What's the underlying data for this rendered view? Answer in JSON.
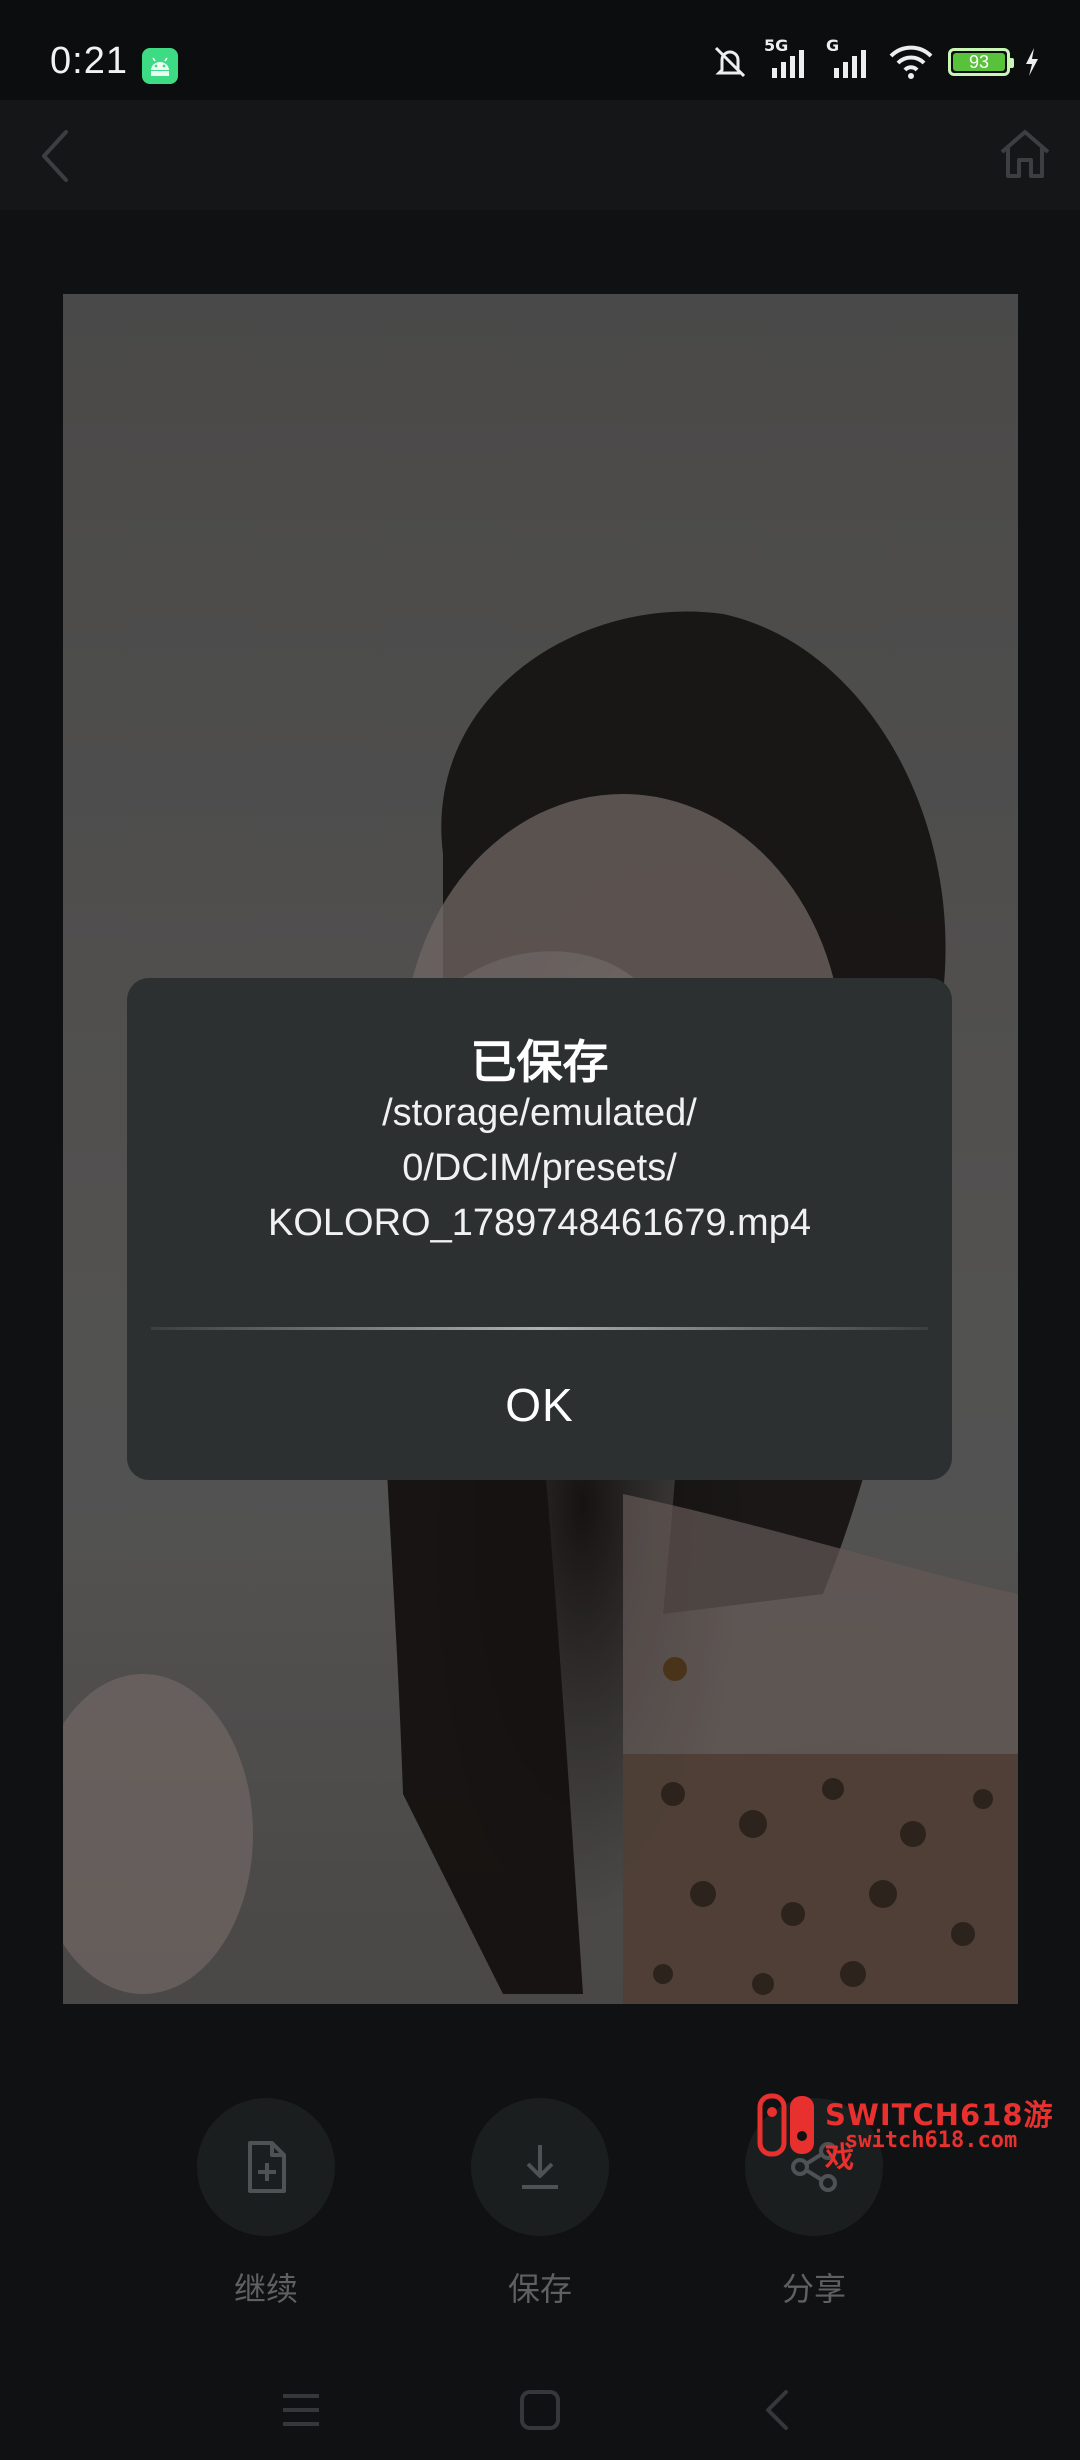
{
  "status_bar": {
    "time": "0:21",
    "network_1": "5G",
    "network_2": "G",
    "battery_percent": "93",
    "icons": [
      "android-icon",
      "mute-icon",
      "signal-icon",
      "signal-icon",
      "wifi-icon",
      "battery-icon",
      "charging-icon"
    ]
  },
  "app_bar": {
    "icons": [
      "back-icon",
      "home-icon"
    ]
  },
  "dialog": {
    "title": "已保存",
    "message_lines": [
      "/storage/emulated/",
      "0/DCIM/presets/",
      "KOLORO_1789748461679.mp4"
    ],
    "ok_label": "OK"
  },
  "actions": [
    {
      "label": "继续",
      "icon": "add-file-icon"
    },
    {
      "label": "保存",
      "icon": "download-icon"
    },
    {
      "label": "分享",
      "icon": "share-icon"
    }
  ],
  "watermark": {
    "title": "SWITCH618游戏",
    "url": "switch618.com"
  },
  "nav_bar": {
    "icons": [
      "menu-icon",
      "home-square-icon",
      "back-icon"
    ]
  },
  "colors": {
    "background": "#0f1112",
    "dialog": "#2c3030",
    "label_dim": "#5d6162",
    "watermark_red": "#e8302e",
    "battery_green": "#58c23a"
  }
}
